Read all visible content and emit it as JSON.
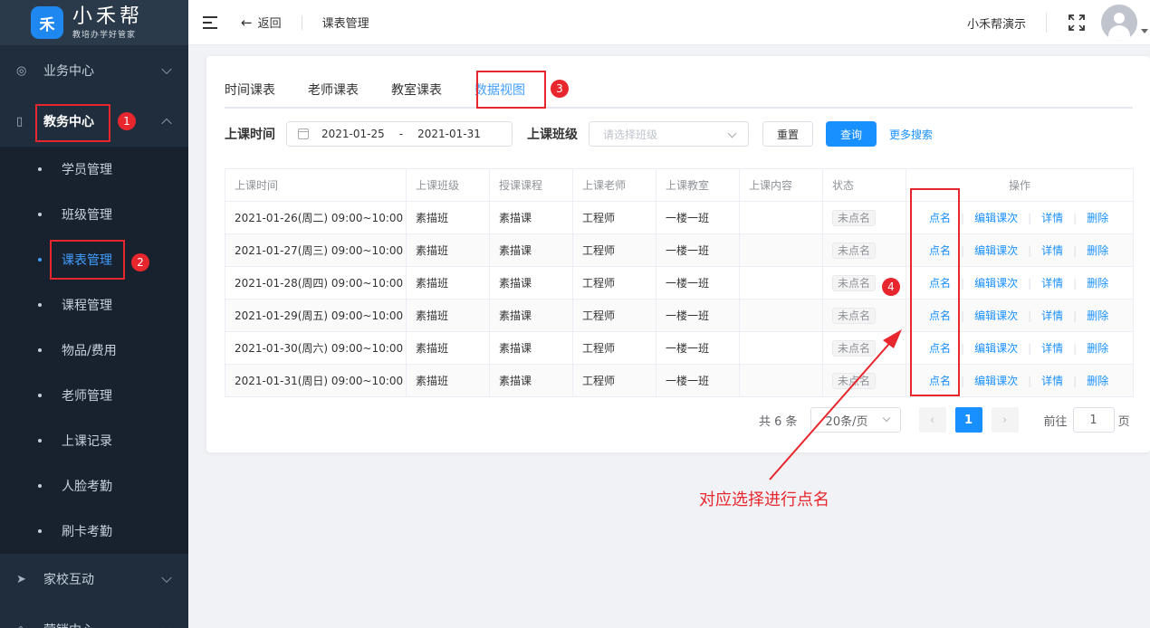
{
  "app": {
    "logo_mark": "禾",
    "name": "小禾帮",
    "slogan": "教培办学好管家"
  },
  "sidebar": {
    "groups": [
      {
        "label": "业务中心",
        "icon": "user-circle-icon"
      },
      {
        "label": "教务中心",
        "icon": "book-icon"
      },
      {
        "label": "家校互动",
        "icon": "send-icon"
      },
      {
        "label": "营销中心",
        "icon": "megaphone-icon"
      }
    ],
    "sub_items": [
      "学员管理",
      "班级管理",
      "课表管理",
      "课程管理",
      "物品/费用",
      "老师管理",
      "上课记录",
      "人脸考勤",
      "刷卡考勤"
    ]
  },
  "header": {
    "back_label": "返回",
    "breadcrumb": "课表管理",
    "username": "小禾帮演示"
  },
  "tabs": [
    "时间课表",
    "老师课表",
    "教室课表",
    "数据视图"
  ],
  "filter": {
    "time_label": "上课时间",
    "date_start": "2021-01-25",
    "date_sep": "-",
    "date_end": "2021-01-31",
    "class_label": "上课班级",
    "class_placeholder": "请选择班级",
    "reset_label": "重置",
    "query_label": "查询",
    "more_label": "更多搜索"
  },
  "table": {
    "headers": [
      "上课时间",
      "上课班级",
      "授课课程",
      "上课老师",
      "上课教室",
      "上课内容",
      "状态",
      "操作"
    ],
    "rows": [
      [
        "2021-01-26(周二) 09:00~10:00",
        "素描班",
        "素描课",
        "工程师",
        "一楼一班",
        "",
        "未点名"
      ],
      [
        "2021-01-27(周三) 09:00~10:00",
        "素描班",
        "素描课",
        "工程师",
        "一楼一班",
        "",
        "未点名"
      ],
      [
        "2021-01-28(周四) 09:00~10:00",
        "素描班",
        "素描课",
        "工程师",
        "一楼一班",
        "",
        "未点名"
      ],
      [
        "2021-01-29(周五) 09:00~10:00",
        "素描班",
        "素描课",
        "工程师",
        "一楼一班",
        "",
        "未点名"
      ],
      [
        "2021-01-30(周六) 09:00~10:00",
        "素描班",
        "素描课",
        "工程师",
        "一楼一班",
        "",
        "未点名"
      ],
      [
        "2021-01-31(周日) 09:00~10:00",
        "素描班",
        "素描课",
        "工程师",
        "一楼一班",
        "",
        "未点名"
      ]
    ],
    "actions": [
      "点名",
      "编辑课次",
      "详情",
      "删除"
    ]
  },
  "pagination": {
    "total": "共 6 条",
    "page_size": "20条/页",
    "current": "1",
    "goto_prefix": "前往",
    "goto_value": "1",
    "goto_suffix": "页"
  },
  "annotations": {
    "markers": [
      "1",
      "2",
      "3",
      "4"
    ],
    "note": "对应选择进行点名"
  },
  "colors": {
    "accent": "#1890ff",
    "sidebar_bg": "#1f2d3d",
    "annotation_red": "#e8262d"
  }
}
